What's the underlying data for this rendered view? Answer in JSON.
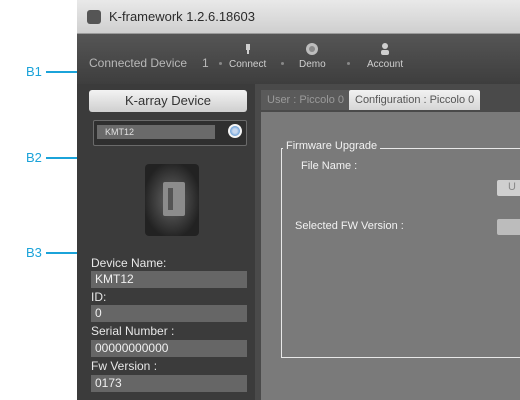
{
  "callouts": [
    {
      "label": "B1"
    },
    {
      "label": "B2"
    },
    {
      "label": "B3"
    }
  ],
  "window": {
    "title": "K-framework 1.2.6.18603"
  },
  "toolbar": {
    "connected_label": "Connected Device",
    "connected_count": "1",
    "buttons": [
      {
        "label": "Connect",
        "icon": "connect-icon"
      },
      {
        "label": "Demo",
        "icon": "demo-icon"
      },
      {
        "label": "Account",
        "icon": "account-icon"
      }
    ]
  },
  "sidebar": {
    "header": "K-array Device",
    "device_item": "KMT12",
    "fields": [
      {
        "label": "Device Name:",
        "value": "KMT12"
      },
      {
        "label": "ID:",
        "value": "0"
      },
      {
        "label": "Serial Number :",
        "value": "00000000000"
      },
      {
        "label": "Fw Version :",
        "value": "0173"
      }
    ]
  },
  "main": {
    "tabs": [
      {
        "label": "User : Piccolo 0",
        "active": false
      },
      {
        "label": "Configuration : Piccolo 0",
        "active": true
      }
    ],
    "firmware": {
      "legend": "Firmware Upgrade",
      "file_name_label": "File Name :",
      "selected_fw_label": "Selected FW Version :",
      "button_partial": "U"
    }
  },
  "colors": {
    "accent": "#1ba3d9",
    "window_bg": "#4a4a4a",
    "panel_bg": "#7a7a7a"
  }
}
